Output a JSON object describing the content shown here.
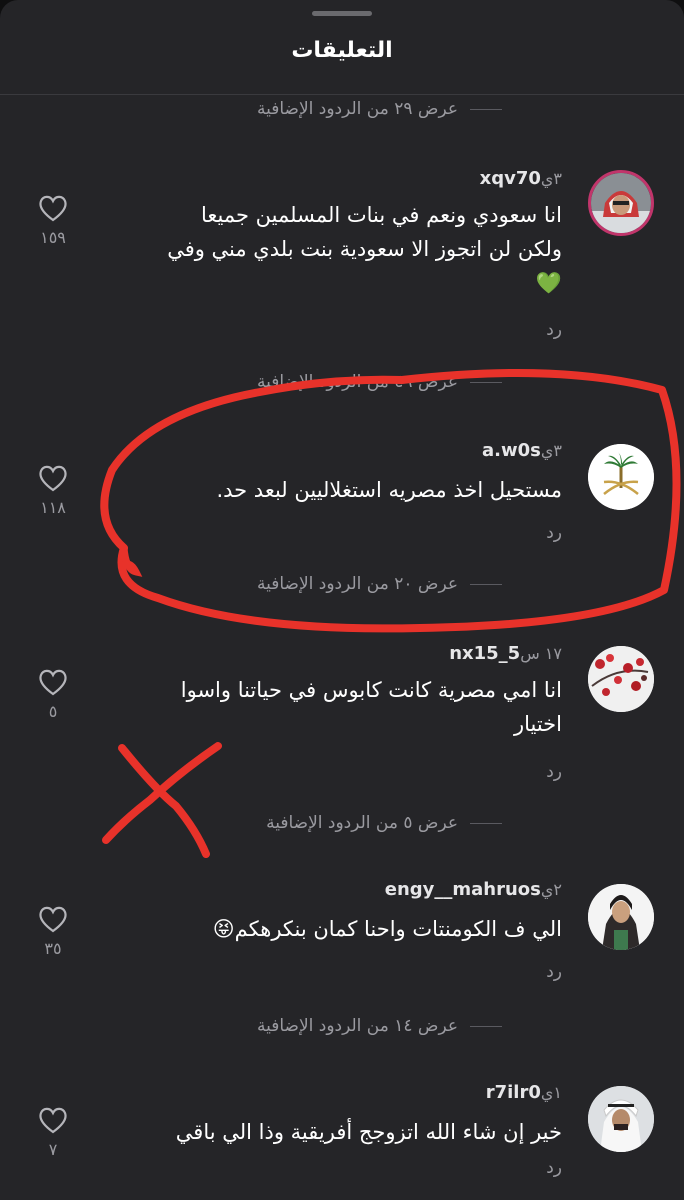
{
  "header": {
    "title": "التعليقات"
  },
  "more_replies": [
    "عرض ٢٩ من الردود الإضافية",
    "عرض ٤٩ من الردود الإضافية",
    "عرض ٢٠ من الردود الإضافية",
    "عرض ٥ من الردود الإضافية",
    "عرض ١٤ من الردود الإضافية"
  ],
  "comments": [
    {
      "username": "xqv70",
      "time": "٣ي",
      "lines": [
        "انا سعودي  ونعم في بنات المسلمين جميعا",
        "ولكن لن  اتجوز الا سعودية بنت بلدي مني وفي",
        "💚"
      ],
      "reply": "رد",
      "likes": "١٥٩"
    },
    {
      "username": "a.w0s",
      "time": "٣ي",
      "lines": [
        "مستحيل اخذ مصريه استغلاليين لبعد حد."
      ],
      "reply": "رد",
      "likes": "١١٨"
    },
    {
      "username": "nx15_5",
      "time": "١٧ س",
      "lines": [
        "انا امي مصرية كانت كابوس في حياتنا واسوا",
        "اختيار"
      ],
      "reply": "رد",
      "likes": "٥"
    },
    {
      "username": "engy__mahruos",
      "time": "٢ي",
      "lines": [
        "الي ف الكومنتات واحنا كمان بنكرهكم😝"
      ],
      "reply": "رد",
      "likes": "٣٥"
    },
    {
      "username": "r7ilr0",
      "time": "١ي",
      "lines": [
        "خير إن شاء الله اتزوجج أفريقية وذا الي باقي"
      ],
      "reply": "رد",
      "likes": "٧"
    }
  ],
  "colors": {
    "background": "#252528",
    "annotation": "#e8322a",
    "gold": "#c8a24a",
    "palm_green": "#2f7a35"
  },
  "icons": {
    "like": "heart-outline-icon"
  }
}
